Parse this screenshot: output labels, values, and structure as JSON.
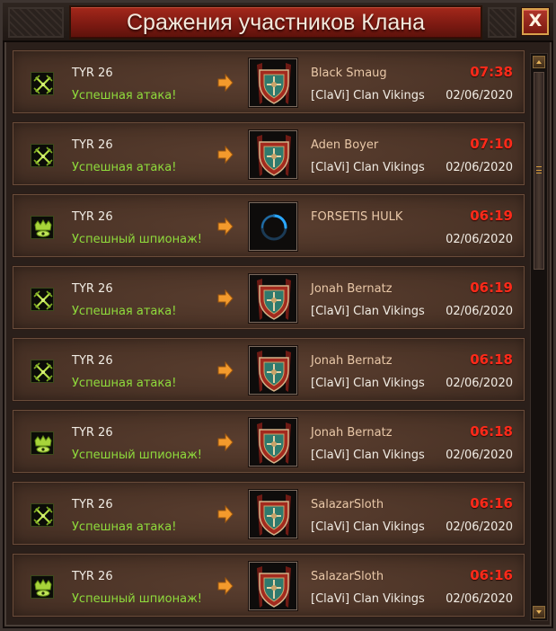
{
  "window": {
    "title": "Сражения участников Клана",
    "close_label": "X"
  },
  "colors": {
    "result_green": "#8fdc3c",
    "time_red": "#ff2a1a",
    "title_red": "#8e1f15",
    "arrow_orange": "#f39a2c"
  },
  "battles": [
    {
      "type": "attack",
      "icon": "crossed-swords-icon",
      "attacker": "TYR 26",
      "result": "Успешная атака!",
      "target": "Black Smaug",
      "clan": "[ClaVi] Clan Vikings",
      "clan_emblem": "clan-shield-icon",
      "time": "07:38",
      "date": "02/06/2020"
    },
    {
      "type": "attack",
      "icon": "crossed-swords-icon",
      "attacker": "TYR 26",
      "result": "Успешная атака!",
      "target": "Aden Boyer",
      "clan": "[ClaVi] Clan Vikings",
      "clan_emblem": "clan-shield-icon",
      "time": "07:10",
      "date": "02/06/2020"
    },
    {
      "type": "spy",
      "icon": "spy-helmet-icon",
      "attacker": "TYR 26",
      "result": "Успешный шпионаж!",
      "target": "FORSETIS HULK",
      "clan": "",
      "clan_emblem": "loading-spinner-icon",
      "time": "06:19",
      "date": "02/06/2020"
    },
    {
      "type": "attack",
      "icon": "crossed-swords-icon",
      "attacker": "TYR 26",
      "result": "Успешная атака!",
      "target": "Jonah Bernatz",
      "clan": "[ClaVi] Clan Vikings",
      "clan_emblem": "clan-shield-icon",
      "time": "06:19",
      "date": "02/06/2020"
    },
    {
      "type": "attack",
      "icon": "crossed-swords-icon",
      "attacker": "TYR 26",
      "result": "Успешная атака!",
      "target": "Jonah Bernatz",
      "clan": "[ClaVi] Clan Vikings",
      "clan_emblem": "clan-shield-icon",
      "time": "06:18",
      "date": "02/06/2020"
    },
    {
      "type": "spy",
      "icon": "spy-helmet-icon",
      "attacker": "TYR 26",
      "result": "Успешный шпионаж!",
      "target": "Jonah Bernatz",
      "clan": "[ClaVi] Clan Vikings",
      "clan_emblem": "clan-shield-icon",
      "time": "06:18",
      "date": "02/06/2020"
    },
    {
      "type": "attack",
      "icon": "crossed-swords-icon",
      "attacker": "TYR 26",
      "result": "Успешная атака!",
      "target": "SalazarSloth",
      "clan": "[ClaVi] Clan Vikings",
      "clan_emblem": "clan-shield-icon",
      "time": "06:16",
      "date": "02/06/2020"
    },
    {
      "type": "spy",
      "icon": "spy-helmet-icon",
      "attacker": "TYR 26",
      "result": "Успешный шпионаж!",
      "target": "SalazarSloth",
      "clan": "[ClaVi] Clan Vikings",
      "clan_emblem": "clan-shield-icon",
      "time": "06:16",
      "date": "02/06/2020"
    }
  ],
  "scrollbar": {
    "position": 0
  }
}
